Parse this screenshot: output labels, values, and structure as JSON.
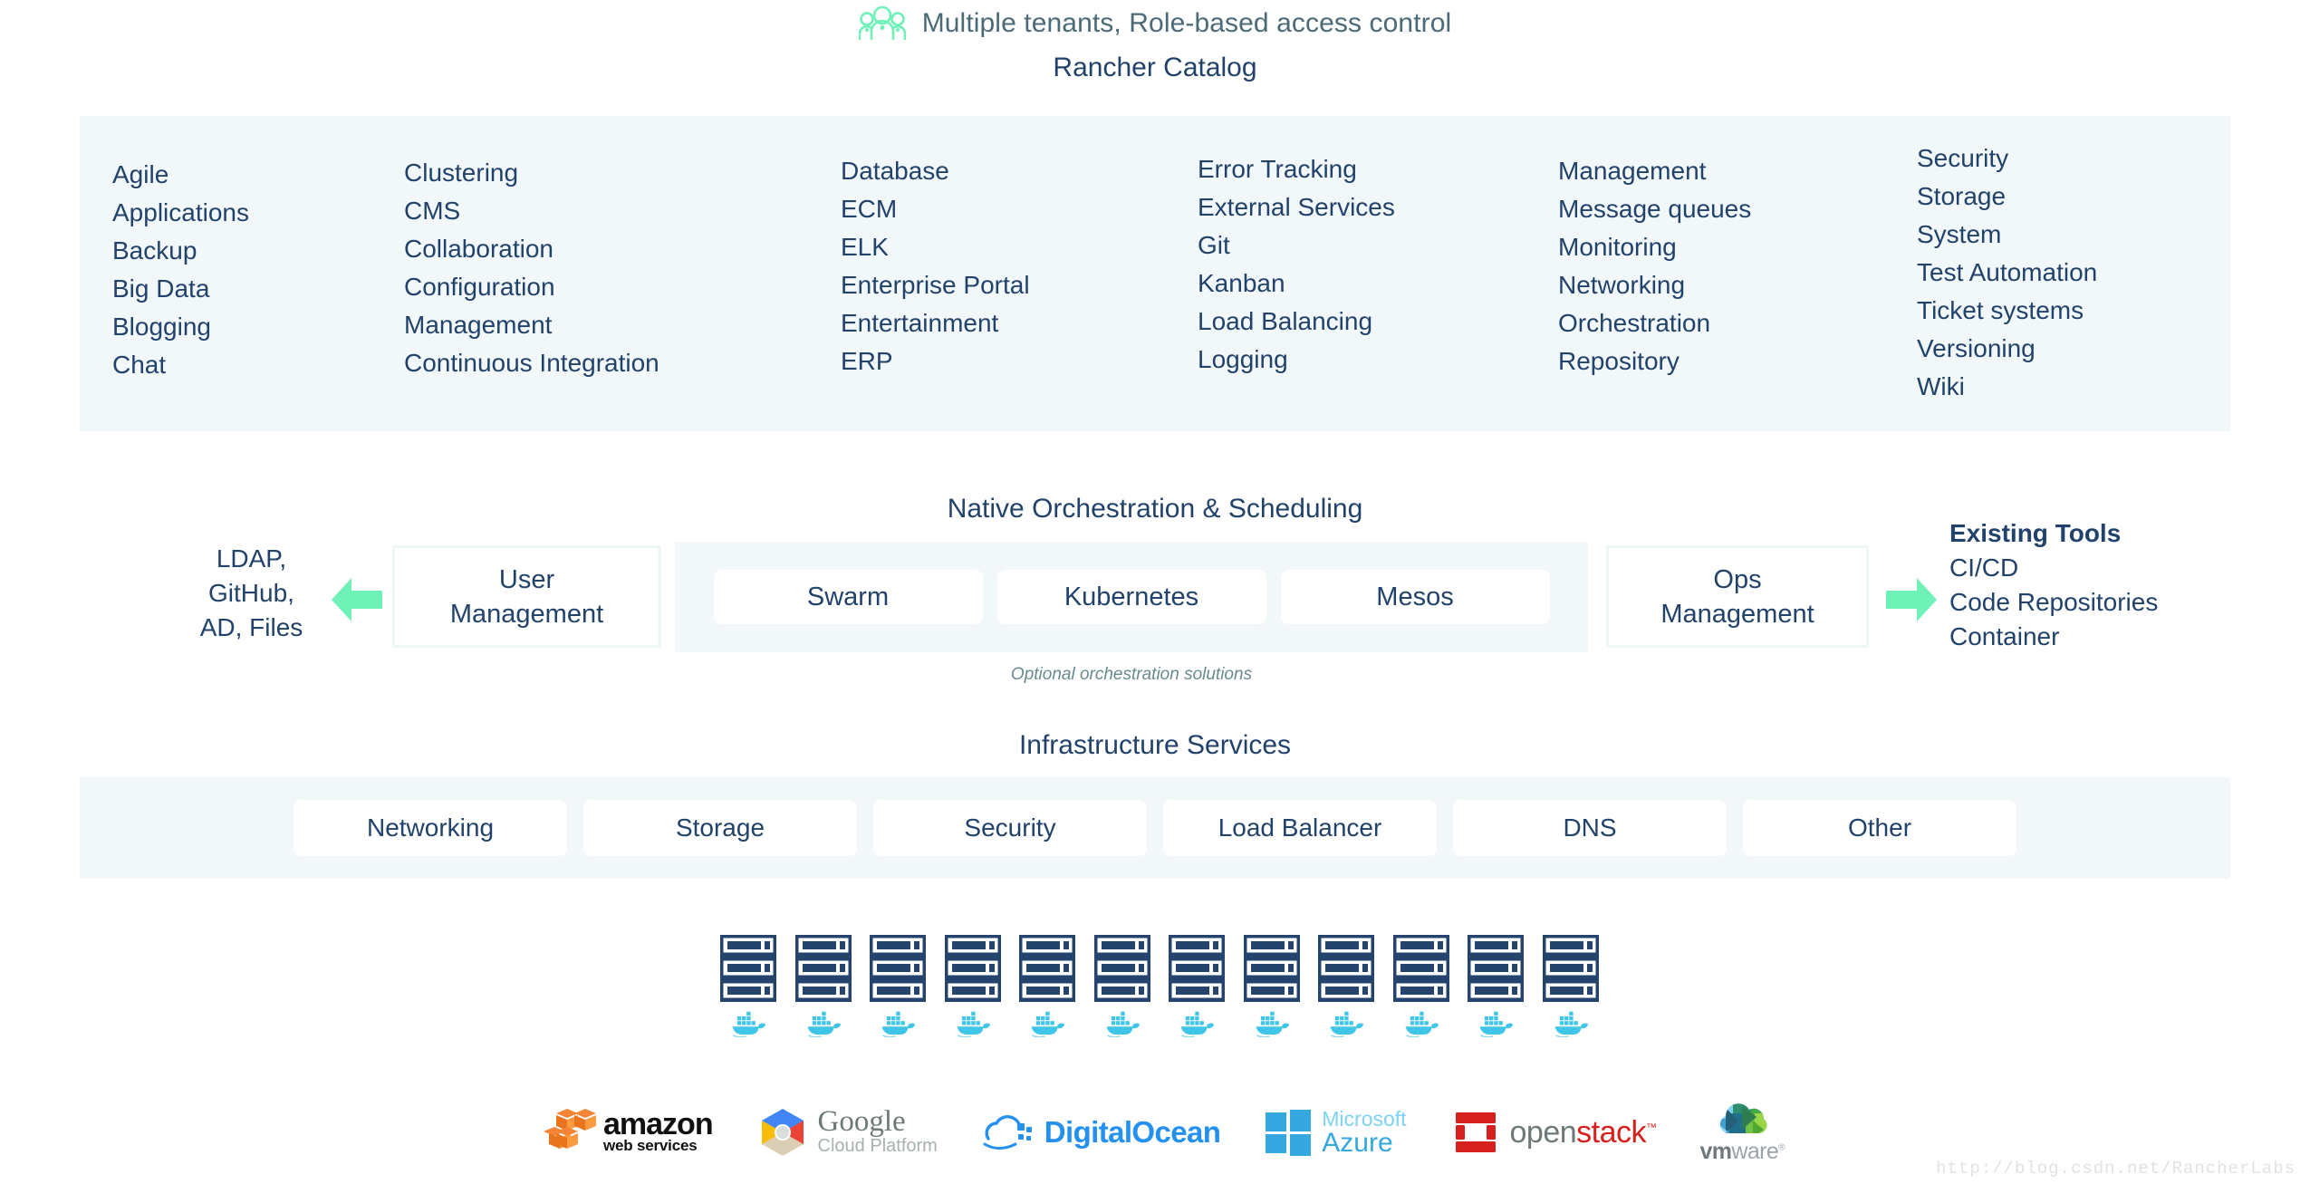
{
  "header": {
    "tenant_icon": "people-group-icon",
    "tenant_text": "Multiple tenants, Role-based access control",
    "catalog_title": "Rancher Catalog"
  },
  "catalog": {
    "columns": [
      {
        "items": [
          "Agile",
          "Applications",
          "Backup",
          "Big Data",
          "Blogging",
          "Chat"
        ]
      },
      {
        "items": [
          "Clustering",
          "CMS",
          "Collaboration",
          "Configuration",
          "Management",
          "Continuous Integration"
        ]
      },
      {
        "items": [
          "Database",
          "ECM",
          "ELK",
          "Enterprise Portal",
          "Entertainment",
          "ERP"
        ]
      },
      {
        "items": [
          "Error Tracking",
          "External Services",
          "Git",
          "Kanban",
          "Load Balancing",
          "Logging"
        ]
      },
      {
        "items": [
          "Management",
          "Message queues",
          "Monitoring",
          "Networking",
          "Orchestration",
          "Repository"
        ]
      },
      {
        "items": [
          "Security",
          "Storage",
          "System",
          "Test Automation",
          "Ticket systems",
          "Versioning",
          "Wiki"
        ]
      }
    ]
  },
  "orchestration": {
    "title": "Native Orchestration & Scheduling",
    "left_sources": [
      "LDAP,",
      "GitHub,",
      "AD, Files"
    ],
    "user_management": "User\nManagement",
    "user_management_line1": "User",
    "user_management_line2": "Management",
    "ops_management_line1": "Ops",
    "ops_management_line2": "Management",
    "engines": [
      "Swarm",
      "Kubernetes",
      "Mesos"
    ],
    "caption": "Optional orchestration solutions",
    "existing_tools_header": "Existing Tools",
    "existing_tools": [
      "CI/CD",
      "Code Repositories",
      "Container"
    ],
    "arrow_left_icon": "arrow-left-icon",
    "arrow_right_icon": "arrow-right-icon"
  },
  "infrastructure": {
    "title": "Infrastructure Services",
    "services": [
      "Networking",
      "Storage",
      "Security",
      "Load Balancer",
      "DNS",
      "Other"
    ]
  },
  "hosts": {
    "count": 12,
    "rack_icon": "server-rack-icon",
    "container_icon": "docker-whale-icon"
  },
  "providers": [
    {
      "name": "amazon-web-services",
      "line1": "amazon",
      "line2": "web services"
    },
    {
      "name": "google-cloud-platform",
      "line1": "Google",
      "line2": "Cloud Platform"
    },
    {
      "name": "digitalocean",
      "line1": "DigitalOcean",
      "line2": ""
    },
    {
      "name": "microsoft-azure",
      "line1": "Microsoft",
      "line2": "Azure"
    },
    {
      "name": "openstack",
      "line1": "open",
      "line2": "stack",
      "tm": "™"
    },
    {
      "name": "vmware",
      "line1": "vm",
      "line2": "ware",
      "tm": "®"
    }
  ],
  "watermark": "http://blog.csdn.net/RancherLabs",
  "colors": {
    "panel_bg": "#f2f8f9",
    "text_navy": "#21426b",
    "accent_mint": "#6ef2b8",
    "tenant_text": "#4b6a78",
    "caption": "#688a8f",
    "docker_blue": "#3ec5e8",
    "rack_navy": "#24436d"
  }
}
